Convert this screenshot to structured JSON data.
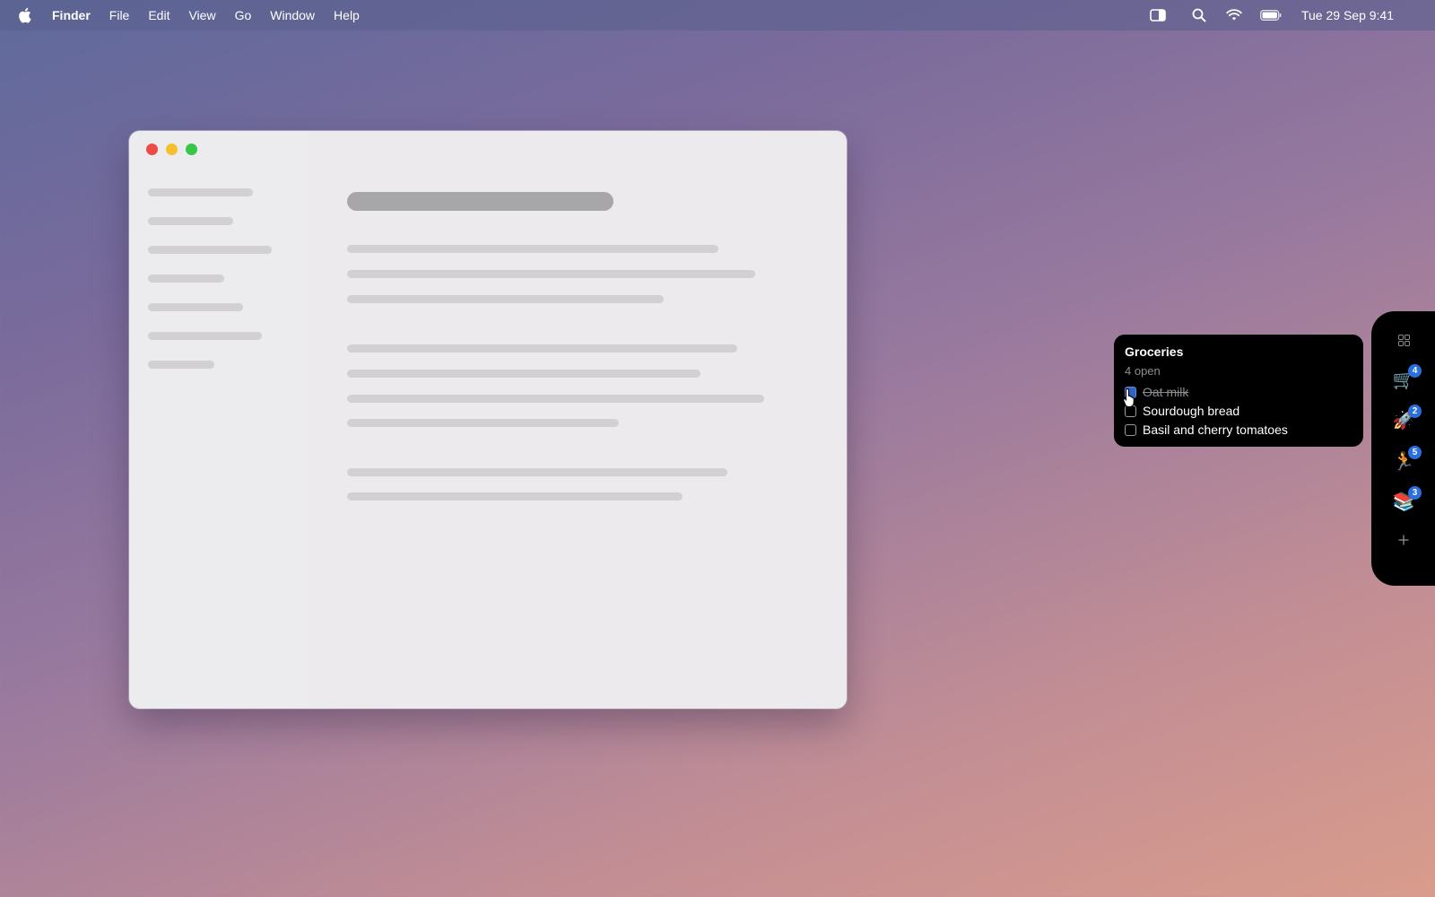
{
  "menubar": {
    "app_name": "Finder",
    "menus": [
      "File",
      "Edit",
      "View",
      "Go",
      "Window",
      "Help"
    ],
    "clock": "Tue 29 Sep  9:41",
    "status_icons": [
      "sidebar-toggle-icon",
      "search-icon",
      "wifi-icon",
      "battery-icon"
    ]
  },
  "widget": {
    "title": "Groceries",
    "subtitle": "4 open",
    "items": [
      {
        "label": "Oat milk",
        "checked": true
      },
      {
        "label": "Sourdough bread",
        "checked": false
      },
      {
        "label": "Basil and cherry tomatoes",
        "checked": false
      }
    ]
  },
  "dock": {
    "items": [
      {
        "icon": "grid-icon",
        "badge": ""
      },
      {
        "icon": "cart-icon",
        "emoji": "🛒",
        "badge": "4"
      },
      {
        "icon": "rocket-icon",
        "emoji": "🚀",
        "badge": "2"
      },
      {
        "icon": "runner-icon",
        "emoji": "🏃",
        "badge": "5"
      },
      {
        "icon": "books-icon",
        "emoji": "📚",
        "badge": "3"
      },
      {
        "icon": "plus-icon",
        "badge": ""
      }
    ]
  },
  "colors": {
    "accent": "#2a6fe0",
    "close": "#ee4b45",
    "minimize": "#f5c02e",
    "zoom": "#36c748"
  }
}
